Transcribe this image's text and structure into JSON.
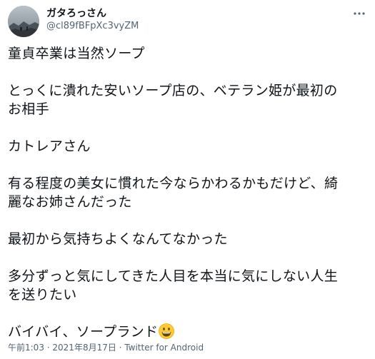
{
  "user": {
    "display_name": "ガタろっさん",
    "handle": "@cl89fBFpXc3vyZM"
  },
  "tweet": {
    "paragraphs": [
      "童貞卒業は当然ソープ",
      "とっくに潰れた安いソープ店の、ベテラン姫が最初の\nお相手",
      "カトレアさん",
      "有る程度の美女に慣れた今ならかわるかもだけど、綺\n麗なお姉さんだった",
      "最初から気持ちよくなんてなかった",
      "多分ずっと気にしてきた人目を本当に気にしない人生\nを送りたい",
      "バイバイ、ソープランド"
    ],
    "last_emoji": "grinning-face"
  },
  "meta": {
    "time": "午前1:03",
    "separator": " · ",
    "date": "2021年8月17日",
    "source": "Twitter for Android"
  },
  "icons": {
    "more": "more-dots-icon",
    "avatar": "avatar-image"
  },
  "colors": {
    "text": "#0f1419",
    "secondary": "#536471",
    "emoji": "#ffcc33"
  }
}
